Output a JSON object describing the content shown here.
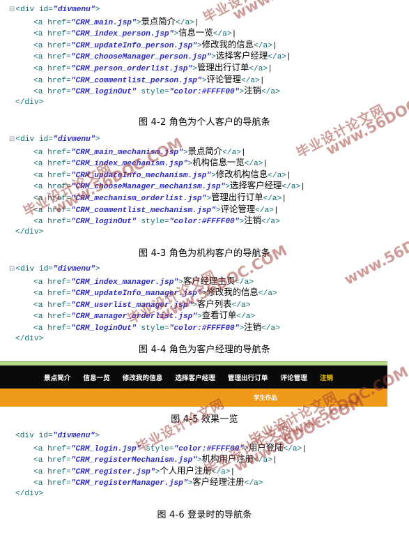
{
  "document": {
    "watermark_text_cn": "毕业设计论文网",
    "watermark_text_en": "www.56DOC.COM",
    "watermark_color": "#9e3b33"
  },
  "blocks": [
    {
      "id": "block-4-2",
      "fold_marker": "⊟",
      "open_tag": "<div id=\"divmenu\">",
      "close_tag": "</div>",
      "links": [
        {
          "href": "CRM_main.jsp",
          "style": "",
          "text": "景点简介",
          "sep": "|"
        },
        {
          "href": "CRM_index_person.jsp",
          "style": "",
          "text": "信息一览",
          "sep": "|"
        },
        {
          "href": "CRM_updateInfo_person.jsp",
          "style": "",
          "text": "修改我的信息",
          "sep": "|"
        },
        {
          "href": "CRM_chooseManager_person.jsp",
          "style": "",
          "text": "选择客户经理",
          "sep": "|"
        },
        {
          "href": "CRM_person_orderlist.jsp",
          "style": "",
          "text": "管理出行订单",
          "sep": "|"
        },
        {
          "href": "CRM_commentlist_person.jsp",
          "style": "",
          "text": "评论管理",
          "sep": "|"
        },
        {
          "href": "CRM_loginOut",
          "style": "color:#FFFF00",
          "text": "注销",
          "sep": ""
        }
      ]
    },
    {
      "id": "block-4-3",
      "fold_marker": "⊟",
      "open_tag": "<div id=\"divmenu\">",
      "close_tag": "</div>",
      "links": [
        {
          "href": "CRM_main_mechanism.jsp",
          "style": "",
          "text": "景点简介",
          "sep": "|"
        },
        {
          "href": "CRM_index_mechanism.jsp",
          "style": "",
          "text": "机构信息一览",
          "sep": "|"
        },
        {
          "href": "CRM_updateInfo_mechanism.jsp",
          "style": "",
          "text": "修改机构信息",
          "sep": "|"
        },
        {
          "href": "CRM_chooseManager_mechanism.jsp",
          "style": "",
          "text": "选择客户经理",
          "sep": "|"
        },
        {
          "href": "CRM_mechanism_orderlist.jsp",
          "style": "",
          "text": "管理出行订单",
          "sep": "|"
        },
        {
          "href": "CRM_commentlist_mechanism.jsp",
          "style": "",
          "text": "评论管理",
          "sep": "|"
        },
        {
          "href": "CRM_loginOut",
          "style": "color:#FFFF00",
          "text": "注销",
          "sep": ""
        }
      ]
    },
    {
      "id": "block-4-4",
      "fold_marker": "⊟",
      "open_tag": "<div id=\"divmenu\">",
      "close_tag": "</div>",
      "links": [
        {
          "href": "CRM_index_manager.jsp",
          "style": "",
          "text": "客户经理主页",
          "sep": ""
        },
        {
          "href": "CRM_updateInfo_manager.jsp",
          "style": "",
          "text": "修改我的信息",
          "sep": ""
        },
        {
          "href": "CRM_userlist_manager.jsp",
          "style": "",
          "text": "客户列表",
          "sep": ""
        },
        {
          "href": "CRM_manager_orderlist.jsp",
          "style": "",
          "text": "查看订单",
          "sep": ""
        },
        {
          "href": "CRM_loginOut",
          "style": "color:#FFFF00",
          "text": "注销",
          "sep": ""
        }
      ]
    },
    {
      "id": "block-4-6",
      "fold_marker": "",
      "open_tag": "<div id=\"divmenu\">",
      "close_tag": "</div>",
      "links": [
        {
          "href": "CRM_login.jsp",
          "style": "color:#FFFF00",
          "text": "用户登陆",
          "sep": "|"
        },
        {
          "href": "CRM_registerMechanism.jsp",
          "style": "",
          "text": "机构用户注册",
          "sep": "|"
        },
        {
          "href": "CRM_register.jsp",
          "style": "",
          "text": "个人用户注册",
          "sep": "|"
        },
        {
          "href": "CRM_registerManager.jsp",
          "style": "",
          "text": "客户经理注册",
          "sep": ""
        }
      ]
    }
  ],
  "captions": {
    "fig_4_2": "图 4-2 角色为个人客户的导航条",
    "fig_4_3": "图 4-3 角色为机构客户的导航条",
    "fig_4_4": "图 4-4 角色为客户经理的导航条",
    "fig_4_5": "图 4-5 效果一览",
    "fig_4_6": "图 4-6 登录时的导航条"
  },
  "navbar_figure": {
    "items": [
      {
        "label": "景点简介",
        "highlight": false
      },
      {
        "label": "信息一览",
        "highlight": false
      },
      {
        "label": "修改我的信息",
        "highlight": false
      },
      {
        "label": "选择客户经理",
        "highlight": false
      },
      {
        "label": "管理出行订单",
        "highlight": false
      },
      {
        "label": "评论管理",
        "highlight": false
      },
      {
        "label": "注销",
        "highlight": true
      }
    ],
    "banner_text": "学生作品",
    "colors": {
      "green": "#b9d98a",
      "black": "#0a0a0a",
      "orange": "#f09a1c",
      "logout_yellow": "#f2c200"
    }
  }
}
